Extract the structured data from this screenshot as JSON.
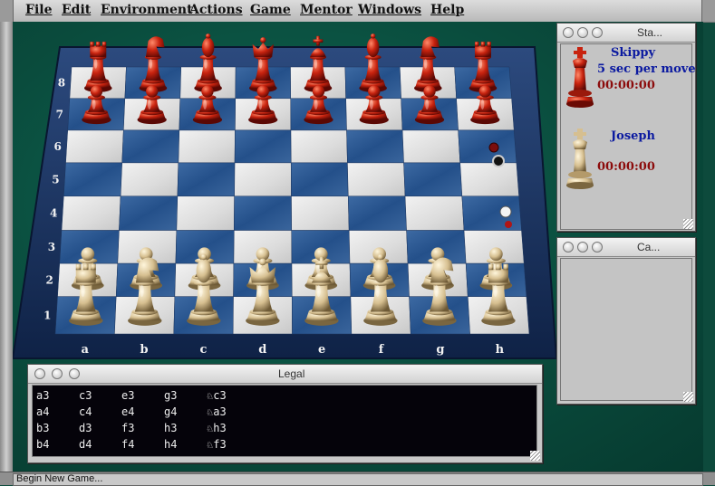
{
  "menubar": [
    "File",
    "Edit",
    "Environment",
    "Actions",
    "Game",
    "Mentor",
    "Windows",
    "Help"
  ],
  "board": {
    "files": [
      "a",
      "b",
      "c",
      "d",
      "e",
      "f",
      "g",
      "h"
    ],
    "ranks": [
      "1",
      "2",
      "3",
      "4",
      "5",
      "6",
      "7",
      "8"
    ],
    "black_back": [
      "rook",
      "knight",
      "bishop",
      "queen",
      "king",
      "bishop",
      "knight",
      "rook"
    ],
    "white_back": [
      "rook",
      "knight",
      "bishop",
      "queen",
      "king",
      "bishop",
      "knight",
      "rook"
    ],
    "black_color": "#c0261a",
    "white_color": "#d9c49a"
  },
  "status_window": {
    "title": "Sta...",
    "black_player": {
      "name": "Skippy",
      "detail": "5 sec per move",
      "clock": "00:00:00",
      "icon": "red-king-icon"
    },
    "white_player": {
      "name": "Joseph",
      "clock": "00:00:00",
      "icon": "white-king-icon"
    }
  },
  "captured_window": {
    "title": "Ca..."
  },
  "legal_window": {
    "title": "Legal",
    "columns": [
      [
        "a3",
        "a4",
        "b3",
        "b4"
      ],
      [
        "c3",
        "c4",
        "d3",
        "d4"
      ],
      [
        "e3",
        "e4",
        "f3",
        "f4"
      ],
      [
        "g3",
        "g4",
        "h3",
        "h4"
      ],
      [
        "♘c3",
        "♘a3",
        "♘h3",
        "♘f3"
      ]
    ]
  },
  "statusbar": {
    "text": "Begin New Game..."
  }
}
